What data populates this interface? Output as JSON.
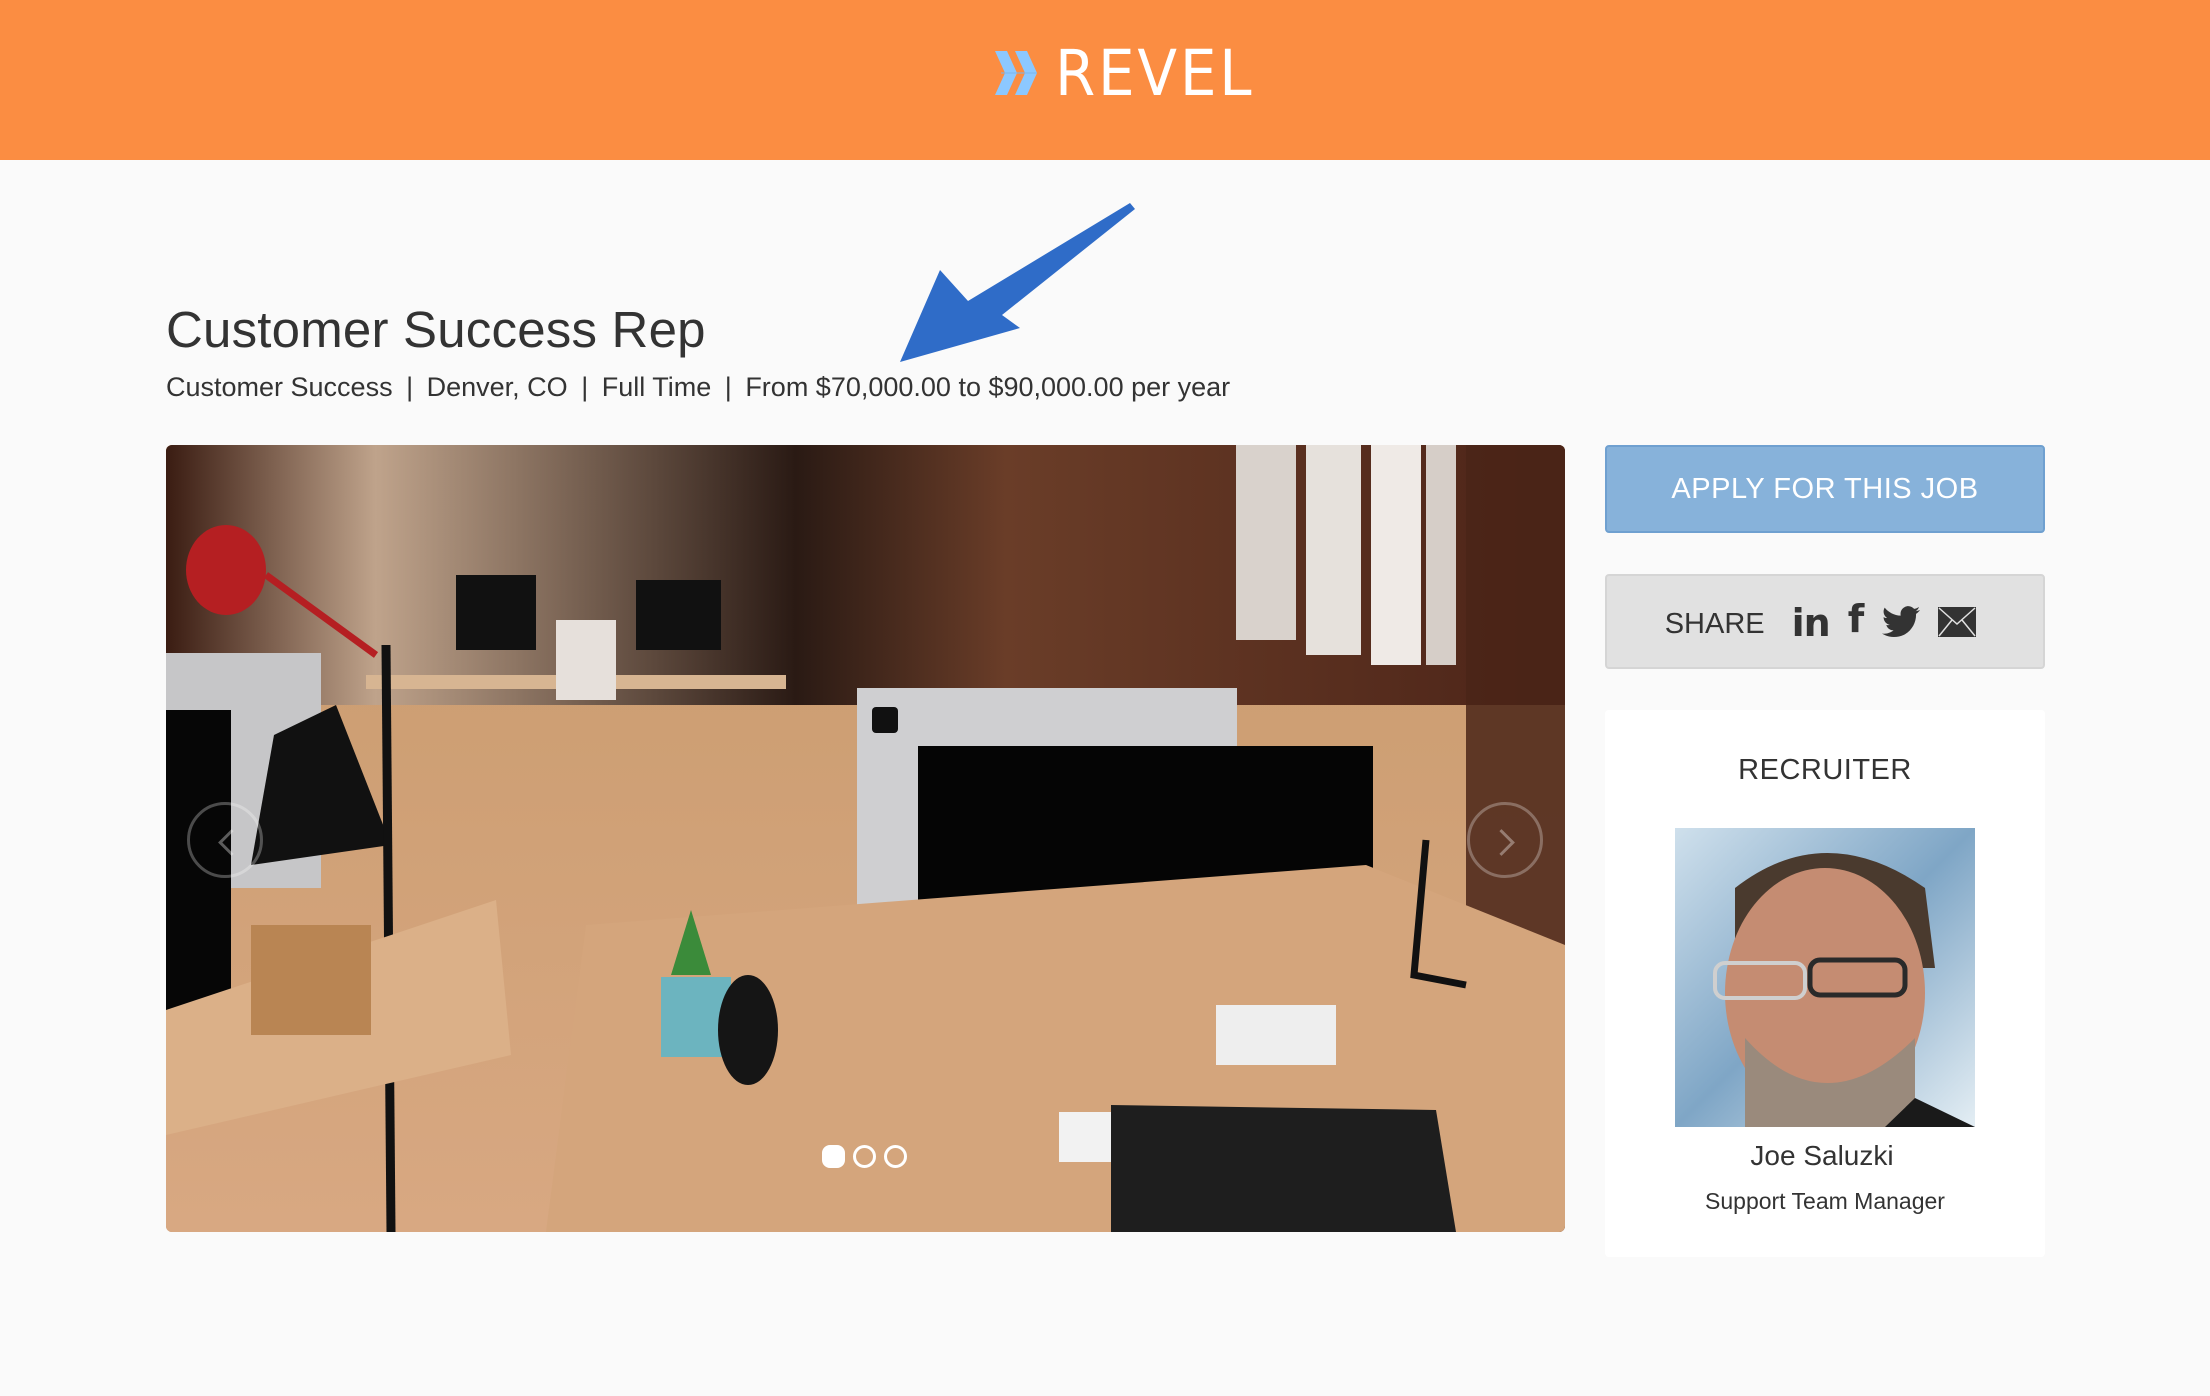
{
  "header": {
    "brand": "REVEL",
    "brand_color": "#fb8d42",
    "logo_icon": "double-chevron-right-icon",
    "logo_icon_color": "#8cc8ff"
  },
  "annotation": {
    "icon": "arrow-pointer-icon",
    "color": "#2f6cc8"
  },
  "job": {
    "title": "Customer Success Rep",
    "department": "Customer Success",
    "location": "Denver, CO",
    "employment_type": "Full Time",
    "salary": "From $70,000.00 to $90,000.00 per year",
    "separator": "|"
  },
  "carousel": {
    "image_description": "Open-plan office with wooden desks, computer monitors, desk lamps and plants",
    "prev_icon": "chevron-left-icon",
    "next_icon": "chevron-right-icon",
    "slide_count": 3,
    "active_slide": 1
  },
  "sidebar": {
    "apply_label": "APPLY FOR THIS JOB",
    "apply_color": "#87b2da",
    "share_label": "SHARE",
    "share_icons": [
      "linkedin-icon",
      "facebook-icon",
      "twitter-icon",
      "email-icon"
    ],
    "linkedin_glyph": "in",
    "facebook_glyph": "f"
  },
  "recruiter": {
    "heading": "RECRUITER",
    "name": "Joe Saluzki",
    "role": "Support Team Manager"
  }
}
